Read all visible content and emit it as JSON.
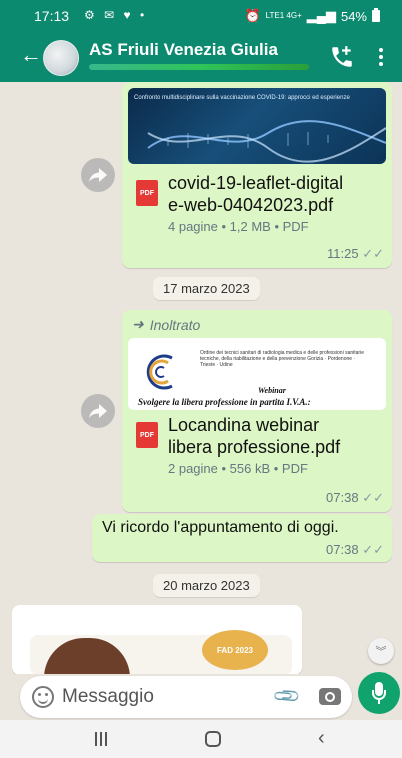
{
  "status_bar": {
    "time": "17:13",
    "network": "LTE1 4G+",
    "battery": "54%"
  },
  "header": {
    "title": "AS Friuli Venezia Giulia"
  },
  "messages": {
    "doc1": {
      "thumb_text": "Confronto multidisciplinare sulla vaccinazione COVID-19: approcci ed esperienze",
      "file_name_line1": "covid-19-leaflet-digital",
      "file_name_line2": "e-web-04042023.pdf",
      "meta": "4 pagine • 1,2 MB • PDF",
      "time": "11:25"
    },
    "date_chip_1": "17 marzo 2023",
    "doc2": {
      "forwarded_label": "Inoltrato",
      "thumb_small_text": "Ordine dei tecnici sanitari di radiologia medica e delle professioni sanitarie tecniche, della riabilitazione e della prevenzione Gorizia · Pordenone · Trieste · Udine",
      "thumb_webinar": "Webinar",
      "thumb_subject": "Svolgere la libera professione in partita I.V.A.:",
      "file_name_line1": "Locandina webinar",
      "file_name_line2": "libera professione.pdf",
      "meta": "2 pagine • 556 kB • PDF",
      "time": "07:38"
    },
    "text1": {
      "text": "Vi ricordo l'appuntamento di oggi.",
      "time": "07:38"
    },
    "date_chip_2": "20 marzo 2023",
    "card": {
      "badge": "FAD 2023"
    }
  },
  "input": {
    "placeholder": "Messaggio"
  },
  "icons": {
    "pdf_label": "PDF"
  },
  "colors": {
    "header": "#0c8a6f",
    "outgoing_bubble": "#dcf7c5",
    "chat_background": "#e9e4dc",
    "mic_button": "#11a36e",
    "pdf": "#e53935"
  }
}
